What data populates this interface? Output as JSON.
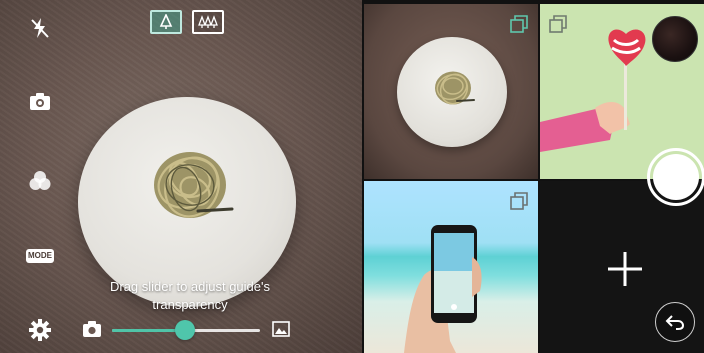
{
  "camera": {
    "mode_label": "MODE",
    "hint_line1": "Drag slider to adjust guide's",
    "hint_line2": "transparency",
    "transparency_slider": {
      "value_fraction": 0.49
    }
  },
  "grid": {
    "panes": [
      "pasta-plate",
      "lollipop",
      "beach-phone",
      "empty"
    ]
  },
  "colors": {
    "accent": "#4fc6ab",
    "highlight": "#5fc7ad",
    "panel_dark": "#141414"
  },
  "icons": {
    "flash": "flash-off-icon",
    "camera_switch": "camera-switch-icon",
    "filter": "filter-icon",
    "settings": "gear-icon",
    "photo": "camera-icon",
    "image": "image-icon",
    "single_guide": "single-guide-icon",
    "multi_guide": "multi-guide-icon",
    "add": "plus-icon",
    "back": "back-arrow-icon"
  }
}
